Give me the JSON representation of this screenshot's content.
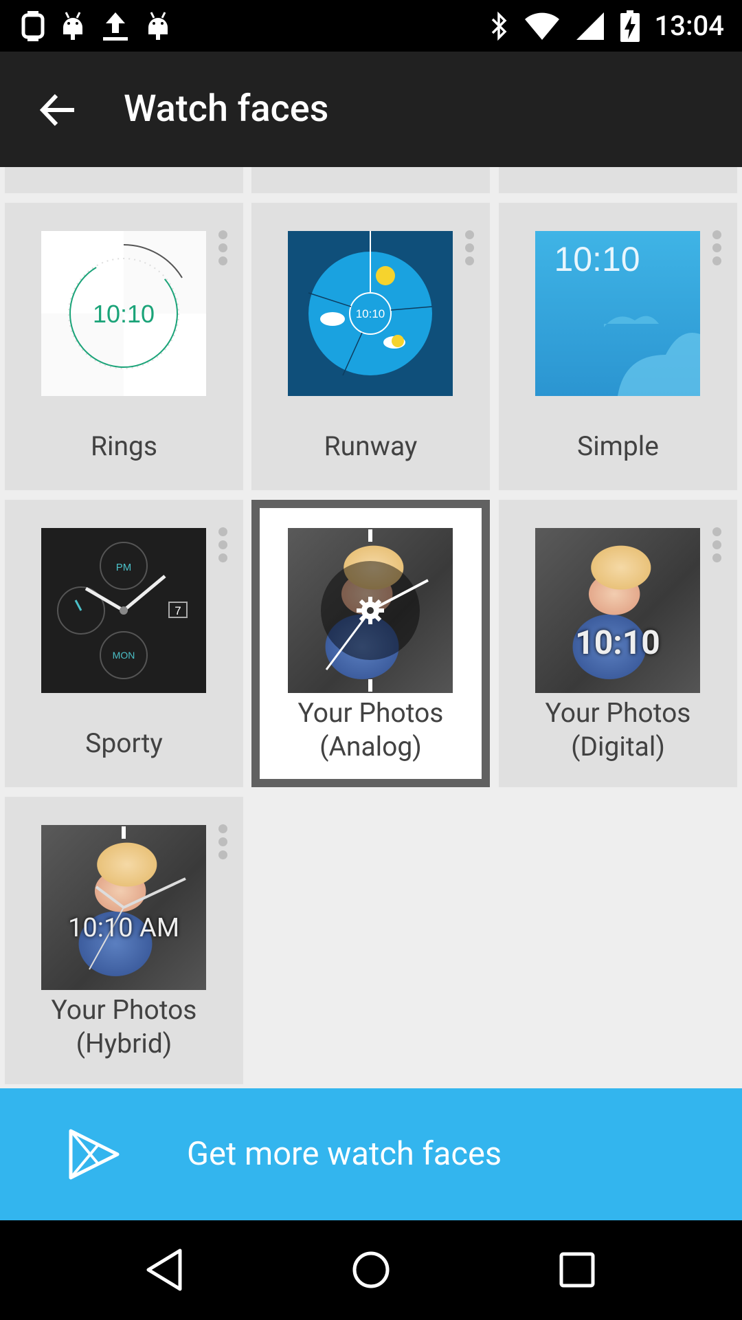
{
  "status_bar": {
    "time": "13:04",
    "left_icons": [
      "watch-icon",
      "android-icon",
      "upload-icon",
      "android-icon"
    ],
    "right_icons": [
      "bluetooth-icon",
      "wifi-icon",
      "signal-icon",
      "battery-charging-icon"
    ]
  },
  "app_bar": {
    "title": "Watch faces",
    "back_icon": "arrow-back-icon"
  },
  "watch_faces": [
    {
      "label": "Rings",
      "time": "10:10",
      "selected": false
    },
    {
      "label": "Runway",
      "time": "10:10",
      "selected": false
    },
    {
      "label": "Simple",
      "time": "10:10",
      "selected": false
    },
    {
      "label": "Sporty",
      "selected": false,
      "subdial_top": "PM",
      "subdial_bottom": "MON",
      "date": "7"
    },
    {
      "label_line1": "Your Photos",
      "label_line2": "(Analog)",
      "selected": true
    },
    {
      "label_line1": "Your Photos",
      "label_line2": "(Digital)",
      "time": "10:10",
      "selected": false
    },
    {
      "label_line1": "Your Photos",
      "label_line2": "(Hybrid)",
      "time": "10:10 AM",
      "selected": false
    }
  ],
  "promo": {
    "label": "Get more watch faces",
    "icon": "play-store-icon"
  },
  "colors": {
    "accent": "#33b5ee",
    "app_bar": "#212121",
    "background": "#eeeeee",
    "tile": "#e0e0e0",
    "ring_green": "#1aa378"
  }
}
